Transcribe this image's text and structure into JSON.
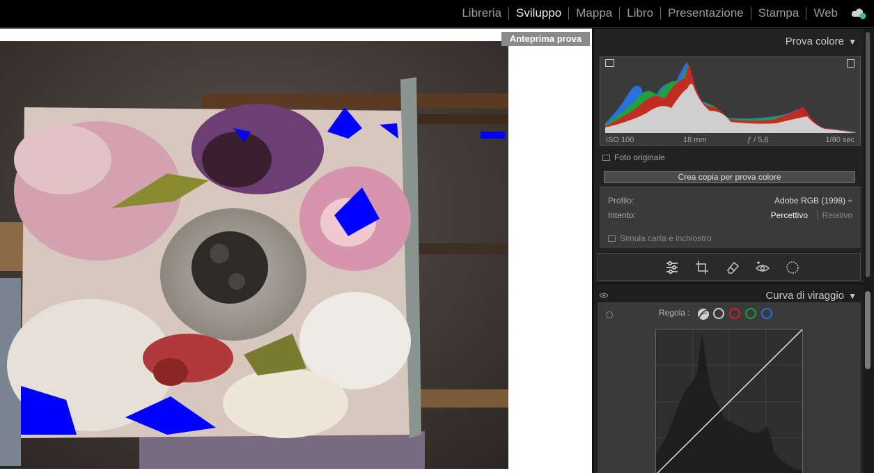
{
  "nav": {
    "modules": [
      {
        "label": "Libreria",
        "active": false
      },
      {
        "label": "Sviluppo",
        "active": true
      },
      {
        "label": "Mappa",
        "active": false
      },
      {
        "label": "Libro",
        "active": false
      },
      {
        "label": "Presentazione",
        "active": false
      },
      {
        "label": "Stampa",
        "active": false
      },
      {
        "label": "Web",
        "active": false
      }
    ],
    "cloud_icon": "cloud-sync-icon"
  },
  "photo": {
    "badge": "Anteprima prova",
    "gamut_warning_color": "#0000ff"
  },
  "soft_proof_panel": {
    "title": "Prova colore",
    "exif": {
      "iso": "ISO 100",
      "focal": "18 mm",
      "aperture": "ƒ / 5,6",
      "shutter": "1/80 sec"
    },
    "original_label": "Foto originale",
    "create_copy_label": "Crea copia per prova colore",
    "profile_label": "Profilo:",
    "profile_value": "Adobe RGB (1998) ÷",
    "intent_label": "Intento:",
    "intent_perceptual": "Percettivo",
    "intent_relative": "Relativo",
    "simulate_label": "Simula carta e inchiostro"
  },
  "tools": [
    "sliders-icon",
    "crop-icon",
    "eraser-icon",
    "redeye-icon",
    "mask-icon"
  ],
  "tone_curve_panel": {
    "title": "Curva di viraggio",
    "adjust_label": "Regola :",
    "channels": [
      {
        "name": "parametric-curve",
        "color": "#cccccc"
      },
      {
        "name": "rgb",
        "color": "#cccccc"
      },
      {
        "name": "red",
        "color": "#d42020"
      },
      {
        "name": "green",
        "color": "#20a040"
      },
      {
        "name": "blue",
        "color": "#2a70e0"
      }
    ]
  },
  "colors": {
    "accent_red": "#d42020",
    "accent_green": "#20a040",
    "accent_blue": "#2a70e0",
    "panel_bg": "#222222"
  }
}
